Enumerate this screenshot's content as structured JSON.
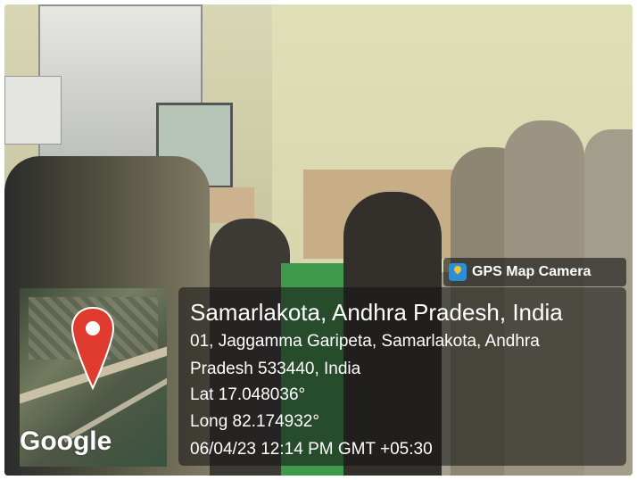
{
  "overlay": {
    "app_name": "GPS Map Camera",
    "place_title": "Samarlakota, Andhra Pradesh, India",
    "address_line1": "01, Jaggamma Garipeta, Samarlakota, Andhra",
    "address_line2": "Pradesh 533440, India",
    "latitude": "Lat 17.048036°",
    "longitude": "Long 82.174932°",
    "timestamp": "06/04/23 12:14 PM GMT +05:30",
    "map_logo_text": "Google",
    "pin_color": "#e03b2f"
  }
}
